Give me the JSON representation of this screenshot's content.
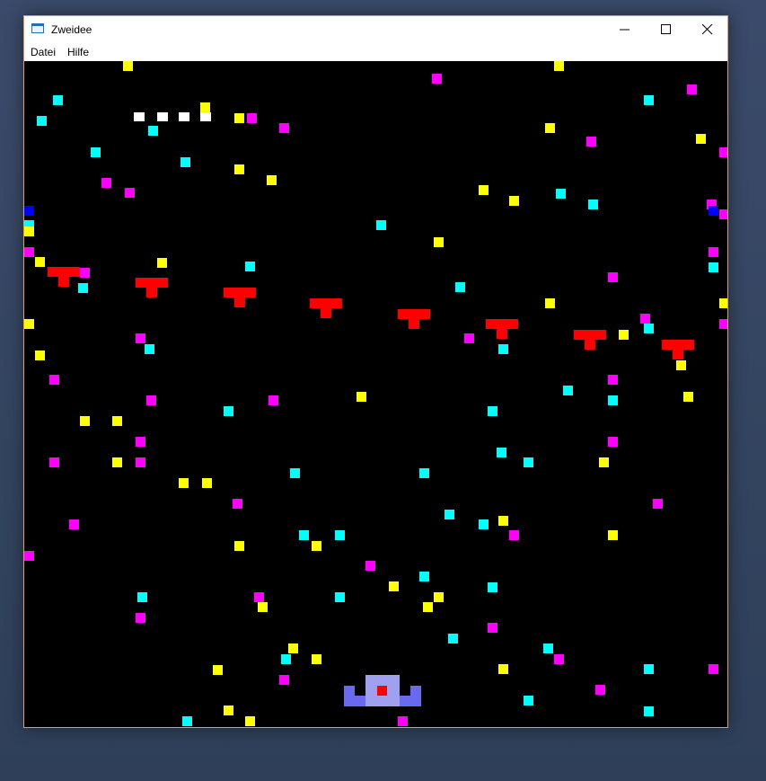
{
  "window": {
    "title": "Zweidee"
  },
  "menu": {
    "items": [
      "Datei",
      "Hilfe"
    ]
  },
  "window_controls": [
    "minimize-icon",
    "maximize-icon",
    "close-icon"
  ],
  "game": {
    "colors": {
      "background": "#000000",
      "cyan": "#00ffff",
      "magenta": "#ff00ff",
      "yellow": "#ffff00",
      "enemy": "#ff0000",
      "ship_light": "#a0a0f0",
      "ship_dark": "#6a6af0",
      "ship_core": "#ff0000",
      "white": "#ffffff",
      "blue": "#0000ff"
    }
  }
}
